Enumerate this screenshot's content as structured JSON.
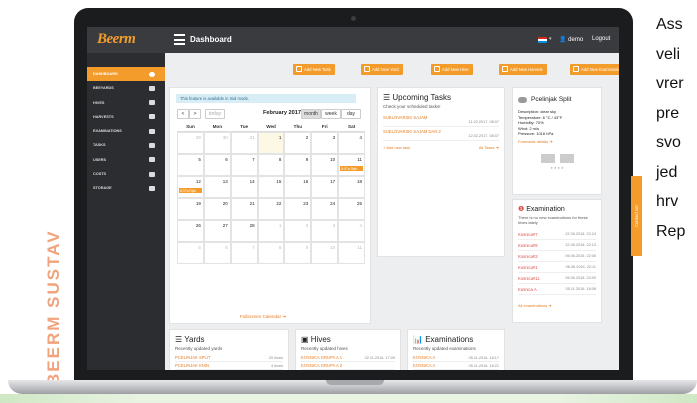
{
  "side_caption": "BEERM SUSTAV",
  "right_text": [
    "Ass",
    "veli",
    "vrer",
    "pre",
    "svo",
    "jed",
    "hrv",
    "Rep"
  ],
  "app": {
    "logo": "Beerm",
    "title": "Dashboard",
    "user": "demo",
    "logout": "Logout"
  },
  "sidebar": {
    "items": [
      {
        "label": "DASHBOARD",
        "icon": "dashboard-icon"
      },
      {
        "label": "BEEYARDS",
        "icon": "list-icon"
      },
      {
        "label": "HIVES",
        "icon": "hive-icon"
      },
      {
        "label": "HARVESTS",
        "icon": "chart-icon"
      },
      {
        "label": "EXAMINATIONS",
        "icon": "bar-chart-icon"
      },
      {
        "label": "TASKS",
        "icon": "calendar-icon"
      },
      {
        "label": "USERS",
        "icon": "users-icon"
      },
      {
        "label": "COSTS",
        "icon": "money-icon"
      },
      {
        "label": "STORAGE",
        "icon": "folder-icon"
      }
    ]
  },
  "quick_actions": [
    "Add New Task",
    "Add New Yard",
    "Add New Hive",
    "Add New Harvest",
    "Add New Examination"
  ],
  "calendar": {
    "notice": "This feature is available in trial mode.",
    "prev": "<",
    "next": ">",
    "today": "today",
    "title": "February 2017",
    "views": [
      "month",
      "week",
      "day"
    ],
    "weekdays": [
      "Sun",
      "Mon",
      "Tue",
      "Wed",
      "Thu",
      "Fri",
      "Sat"
    ],
    "weeks": [
      [
        "29",
        "30",
        "31",
        "1",
        "2",
        "3",
        "4"
      ],
      [
        "5",
        "6",
        "7",
        "8",
        "9",
        "10",
        "11"
      ],
      [
        "12",
        "13",
        "14",
        "15",
        "16",
        "17",
        "18"
      ],
      [
        "19",
        "20",
        "21",
        "22",
        "23",
        "24",
        "25"
      ],
      [
        "26",
        "27",
        "28",
        "1",
        "2",
        "3",
        "4"
      ],
      [
        "5",
        "6",
        "7",
        "8",
        "9",
        "10",
        "11"
      ]
    ],
    "event_label": "8:07a Rjsh",
    "fullscreen": "Fullscreen Calendar"
  },
  "tasks": {
    "title": "Upcoming Tasks",
    "subtitle": "Check your scheduled tasks!",
    "items": [
      {
        "name": "SUELOVARSKI SAJAM",
        "date": "11.02.2017. 08:07"
      },
      {
        "name": "SUELOVARSKI SAJAM DAN 2",
        "date": "12.02.2017. 08:07"
      }
    ],
    "add": "Add new task",
    "all": "All Tasks"
  },
  "weather": {
    "place": "Pcelinjak Split",
    "lines": [
      "Description: clear sky",
      "Temperature: 6 °C / 43°F",
      "Humidity: 70%",
      "Wind: 2 m/s",
      "Pressure: 1016 hPa"
    ],
    "forecast": "Forecasts details"
  },
  "examination_box": {
    "title": "Examination",
    "subtitle": "There is no new examinations for these hives lately",
    "rows": [
      {
        "hive": "Kosnica#7",
        "date": "22.06.2016. 22:24"
      },
      {
        "hive": "Kosnica#9",
        "date": "22.06.2016. 22:13"
      },
      {
        "hive": "Kosnica#3",
        "date": "06.06.2016. 22:06"
      },
      {
        "hive": "Kosnica#1",
        "date": "06.06.2016. 22:11"
      },
      {
        "hive": "Kosnica#11",
        "date": "06.06.2016. 22:09"
      },
      {
        "hive": "Kosnica A",
        "date": "05.11.2016. 18:08"
      }
    ],
    "all": "All examinations"
  },
  "contact_tab": "Contact us!",
  "yards": {
    "title": "Yards",
    "subtitle": "Recently updated yards",
    "rows": [
      {
        "name": "PCELINJAK SPLIT",
        "count": "20 hives"
      },
      {
        "name": "PCELINJAK KNIN",
        "count": "4 hives"
      }
    ]
  },
  "hives": {
    "title": "Hives",
    "subtitle": "Recently updated hives",
    "rows": [
      {
        "name": "KOSNICA GRUPA A 1",
        "date": "02.11.2016. 17:09"
      },
      {
        "name": "KOSNICA GRUPA A 2",
        "date": ""
      }
    ]
  },
  "examinations": {
    "title": "Examinations",
    "subtitle": "Recently updated examinations",
    "rows": [
      {
        "name": "KOSNICA A",
        "date": "05.11.2016. 18:17"
      },
      {
        "name": "KOSNICA A",
        "date": "05.11.2016. 18:21"
      }
    ]
  }
}
